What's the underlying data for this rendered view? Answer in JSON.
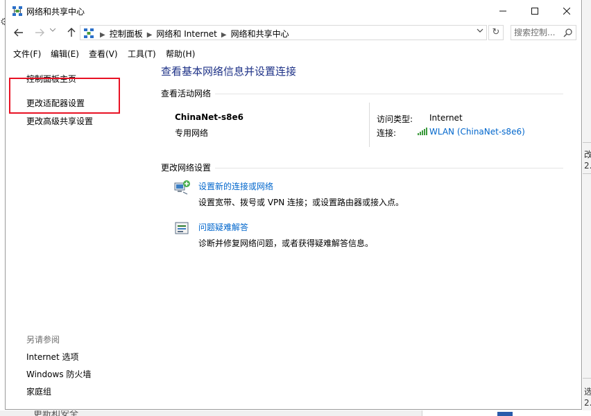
{
  "window": {
    "title": "网络和共享中心",
    "app_icon": "network-center-icon"
  },
  "nav": {
    "back_icon": "back-arrow-icon",
    "forward_icon": "forward-arrow-icon",
    "recent_icon": "chevron-down-icon",
    "up_icon": "up-arrow-icon",
    "breadcrumbs": [
      "控制面板",
      "网络和 Internet",
      "网络和共享中心"
    ],
    "search_placeholder": "搜索控制..."
  },
  "menu": [
    {
      "label": "文件(F)"
    },
    {
      "label": "编辑(E)"
    },
    {
      "label": "查看(V)"
    },
    {
      "label": "工具(T)"
    },
    {
      "label": "帮助(H)"
    }
  ],
  "sidebar": {
    "links": [
      {
        "label": "控制面板主页"
      },
      {
        "label": "更改适配器设置"
      },
      {
        "label": "更改高级共享设置"
      }
    ],
    "see_also_title": "另请参阅",
    "see_also": [
      {
        "label": "Internet 选项"
      },
      {
        "label": "Windows 防火墙"
      },
      {
        "label": "家庭组"
      }
    ]
  },
  "main": {
    "heading": "查看基本网络信息并设置连接",
    "active_section_title": "查看活动网络",
    "network": {
      "name": "ChinaNet-s8e6",
      "type": "专用网络",
      "access_type_label": "访问类型:",
      "access_type_value": "Internet",
      "connection_label": "连接:",
      "connection_value": "WLAN (ChinaNet-s8e6)"
    },
    "change_section_title": "更改网络设置",
    "tasks": [
      {
        "icon": "new-connection-icon",
        "link": "设置新的连接或网络",
        "desc": "设置宽带、拨号或 VPN 连接；或设置路由器或接入点。"
      },
      {
        "icon": "troubleshoot-icon",
        "link": "问题疑难解答",
        "desc": "诊断并修复网络问题，或者获得疑难解答信息。"
      }
    ]
  },
  "background": {
    "bottom_text": "更新和安全",
    "right_chars": [
      "改",
      "2.",
      "选",
      "2."
    ]
  },
  "colors": {
    "heading": "#1e3287",
    "link": "#0066cc",
    "highlight_box": "#e81123",
    "muted": "#6d6d6d"
  }
}
